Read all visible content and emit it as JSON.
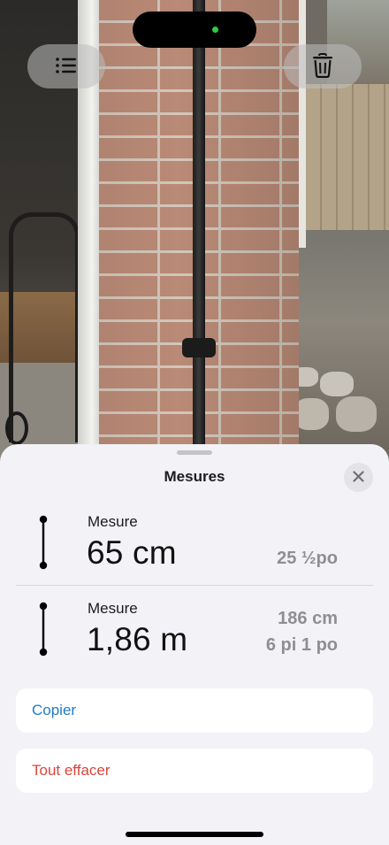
{
  "icons": {
    "list": "list-icon",
    "trash": "trash-icon",
    "close": "close-icon",
    "measure": "vertical-measure-icon"
  },
  "colors": {
    "accent": "#1f7cc3",
    "destructive": "#d9453a",
    "secondary_text": "#8e8e93",
    "sheet_background": "#f2f2f7"
  },
  "sheet": {
    "title": "Mesures"
  },
  "measurements": [
    {
      "label": "Mesure",
      "value": "65 cm",
      "alt": [
        "25 ½po"
      ]
    },
    {
      "label": "Mesure",
      "value": "1,86 m",
      "alt": [
        "186 cm",
        "6 pi 1 po"
      ]
    }
  ],
  "actions": {
    "copy": "Copier",
    "clear_all": "Tout effacer"
  }
}
